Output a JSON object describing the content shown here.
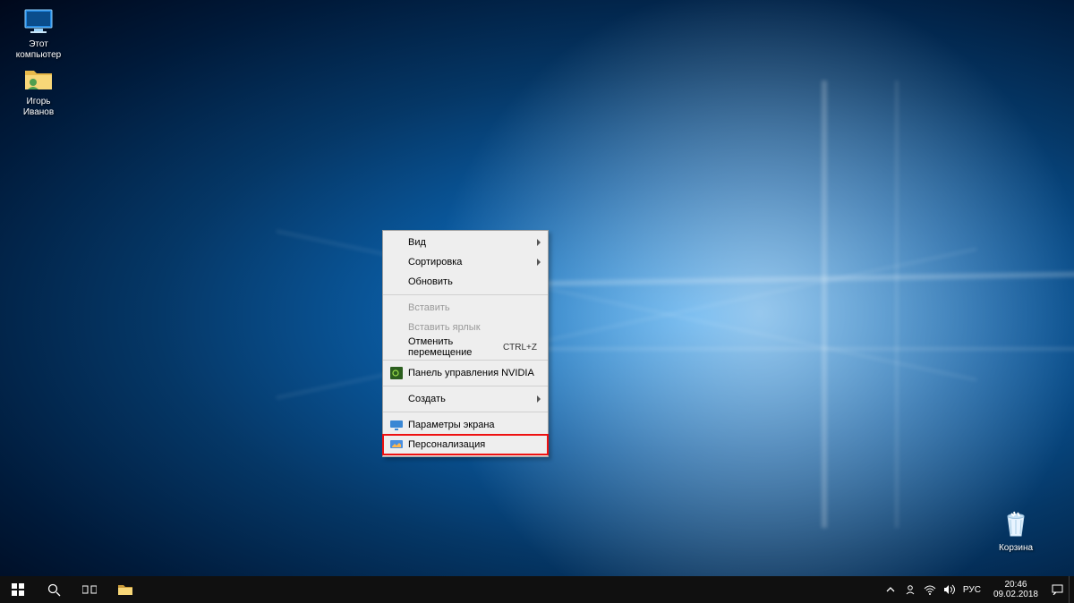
{
  "desktop_icons": {
    "this_pc": "Этот\nкомпьютер",
    "user_folder": "Игорь\nИванов",
    "recycle_bin": "Корзина"
  },
  "context_menu": {
    "view": "Вид",
    "sort": "Сортировка",
    "refresh": "Обновить",
    "paste": "Вставить",
    "paste_shortcut": "Вставить ярлык",
    "undo_move": "Отменить перемещение",
    "undo_shortcut": "CTRL+Z",
    "nvidia": "Панель управления NVIDIA",
    "create": "Создать",
    "display_settings": "Параметры экрана",
    "personalize": "Персонализация"
  },
  "tray": {
    "lang": "РУС",
    "time": "20:46",
    "date": "09.02.2018"
  }
}
